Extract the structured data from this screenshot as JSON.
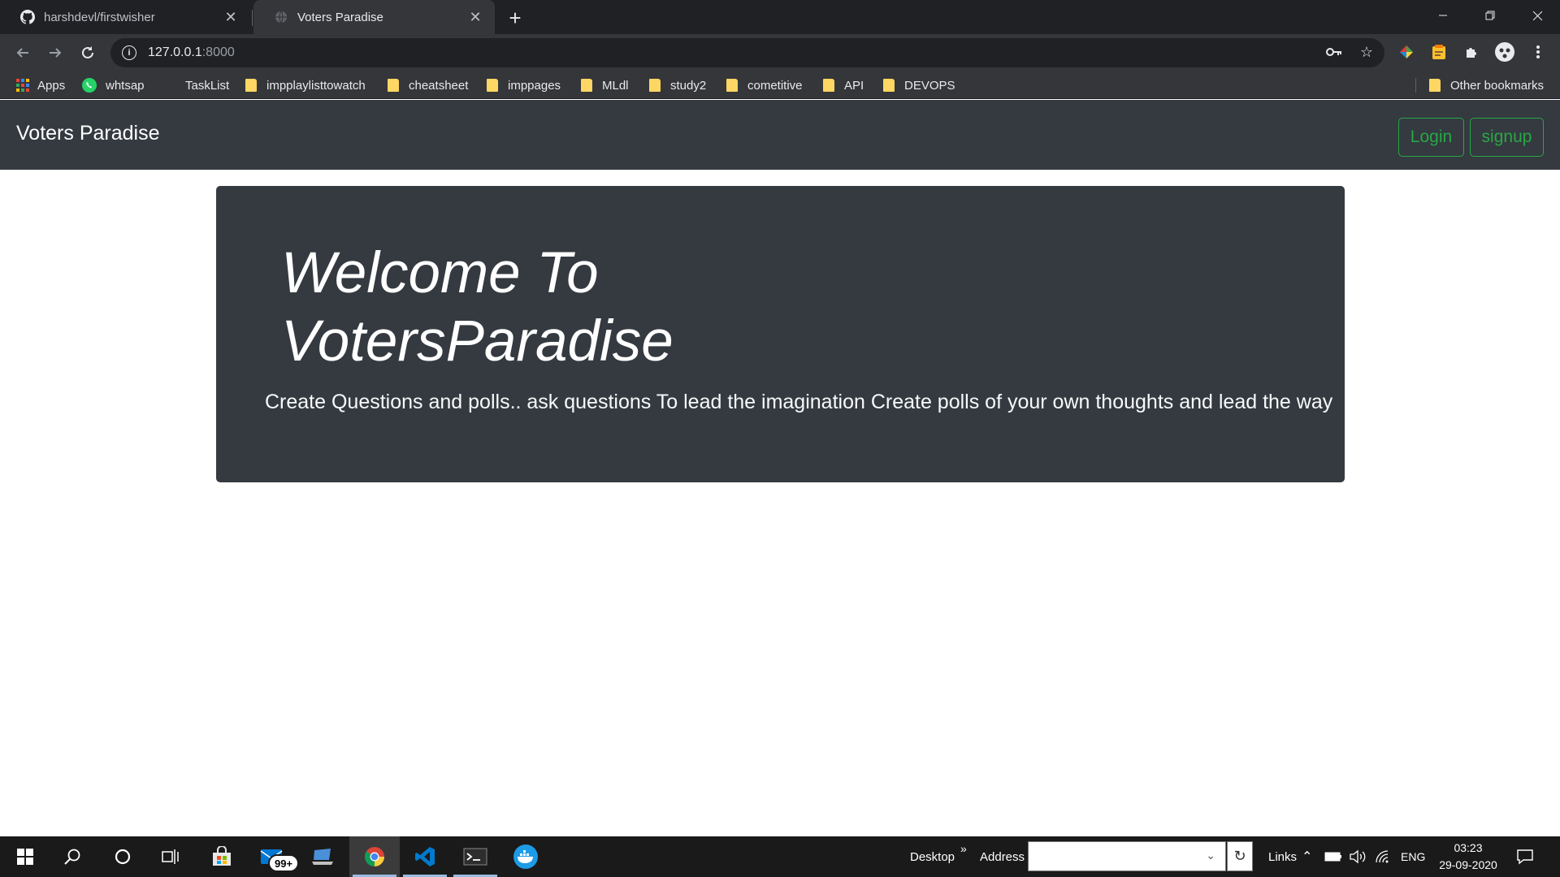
{
  "browser": {
    "tabs": [
      {
        "title": "harshdevl/firstwisher",
        "active": false,
        "favicon": "github-icon"
      },
      {
        "title": "Voters Paradise",
        "active": true,
        "favicon": "globe-icon"
      }
    ],
    "url_host": "127.0.0.1",
    "url_port": ":8000",
    "bookmarks": {
      "apps": "Apps",
      "whtsap": "whtsap",
      "tasklist": "TaskList",
      "folders": [
        "impplaylisttowatch",
        "cheatsheet",
        "imppages",
        "MLdl",
        "study2",
        "cometitive",
        "API",
        "DEVOPS"
      ],
      "other": "Other bookmarks"
    }
  },
  "site": {
    "brand": "Voters Paradise",
    "login_label": "Login",
    "signup_label": "signup",
    "accent_color": "#28a745",
    "jumbotron": {
      "title": "Welcome To VotersParadise",
      "lead": "Create Questions and polls.. ask questions To lead the imagination Create polls of your own thoughts and lead the way"
    }
  },
  "taskbar": {
    "desktop_label": "Desktop",
    "address_label": "Address",
    "address_value": "",
    "links_label": "Links",
    "language": "ENG",
    "time": "03:23",
    "date": "29-09-2020",
    "mail_badge": "99+"
  }
}
